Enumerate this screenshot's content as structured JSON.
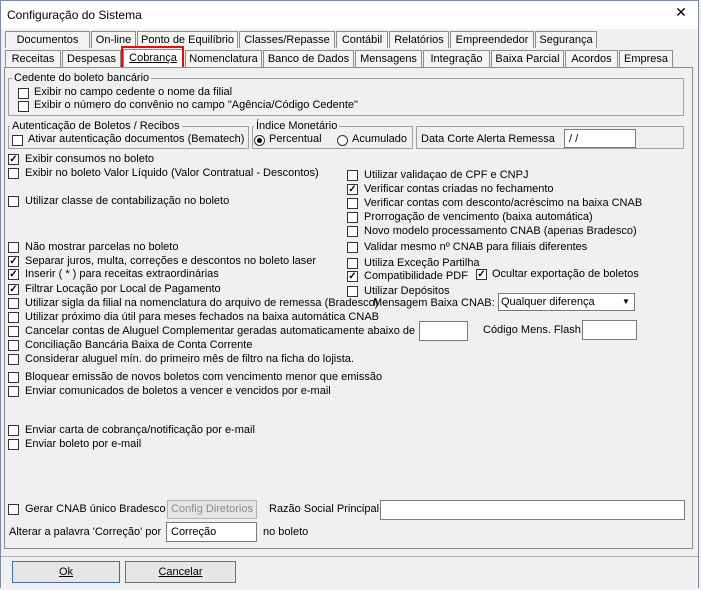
{
  "window": {
    "title": "Configuração do Sistema",
    "close_glyph": "✕"
  },
  "tabs_row1": [
    "Documentos",
    "On-line",
    "Ponto de Equilíbrio",
    "Classes/Repasse",
    "Contábil",
    "Relatórios",
    "Empreendedor",
    "Segurança"
  ],
  "tabs_row2": [
    "Receitas",
    "Despesas",
    "Cobrança",
    "Nomenclatura",
    "Banco de Dados",
    "Mensagens",
    "Integração",
    "Baixa Parcial",
    "Acordos",
    "Empresa"
  ],
  "cedente": {
    "title": "Cedente do boleto bancário",
    "opt1": "Exibir no campo cedente o nome da filial",
    "opt2": "Exibir o número do convênio no campo \"Agência/Código Cedente\""
  },
  "autenticacao": {
    "title": "Autenticação de Boletos / Recibos",
    "opt1": "Ativar autenticação documentos (Bematech)"
  },
  "indice": {
    "title": "Índice Monetário",
    "radio1": "Percentual",
    "radio2": "Acumulado"
  },
  "data_corte": {
    "label": "Data Corte Alerta Remessa",
    "value": "/ /"
  },
  "left_opts": {
    "exibir_consumos": "Exibir consumos no boleto",
    "exibir_valor_liquido": "Exibir no boleto Valor Líquido (Valor Contratual - Descontos)",
    "classe_contab": "Utilizar classe de contabilização no boleto",
    "nao_mostrar_parcelas": "Não mostrar parcelas no boleto",
    "separar_juros": "Separar juros, multa, correções e descontos no boleto laser",
    "inserir": "Inserir ( * ) para receitas extraordinárias",
    "filtrar_locacao": "Filtrar Locação por Local de Pagamento",
    "sigla_filial": "Utilizar sigla da filial na nomenclatura do arquivo de remessa (Bradesco)",
    "proximo_dia": "Utilizar próximo dia útil para meses fechados na baixa automática CNAB",
    "cancelar_contas": "Cancelar contas de Aluguel Complementar geradas automaticamente abaixo de R$",
    "conciliacao": "Conciliação Bancária Baixa de Conta Corrente",
    "considerar_aluguel": "Considerar aluguel mín. do primeiro mês de filtro na ficha do lojista.",
    "bloquear_emissao": "Bloquear emissão de novos boletos com vencimento menor que emissão",
    "enviar_comunicados": "Enviar comunicados de boletos a vencer e vencidos por e-mail",
    "enviar_carta": "Enviar carta de cobrança/notificação por e-mail",
    "enviar_boleto": "Enviar boleto por e-mail"
  },
  "right_opts": {
    "validacao_cpf": "Utilizar validaçao de CPF e CNPJ",
    "verificar_criadas": "Verificar contas criadas no fechamento",
    "verificar_desconto": "Verificar contas com desconto/acréscimo na baixa CNAB",
    "prorrogacao": "Prorrogação de vencimento (baixa automática)",
    "novo_modelo": "Novo modelo processamento CNAB (apenas Bradesco)",
    "validar_mesmo": "Validar mesmo nº CNAB para filiais diferentes",
    "excecao_partilha": "Utiliza Exceção Partilha",
    "compat_pdf": "Compatibilidade PDF",
    "ocultar_exportacao": "Ocultar exportação de boletos",
    "utilizar_depositos": "Utilizar Depósitos"
  },
  "mensagem_baixa": {
    "label": "Mensagem Baixa CNAB:",
    "value": "Qualquer diferença"
  },
  "codigo_mens": {
    "label": "Código Mens. Flash:",
    "value": ""
  },
  "cancelar_valor": "",
  "gerar_cnab": {
    "label": "Gerar CNAB único Bradesco",
    "button": "Config Diretorios"
  },
  "razao_social": {
    "label": "Razão Social Principal",
    "value": ""
  },
  "alterar_palavra": {
    "label": "Alterar a palavra 'Correção' por",
    "value": "Correção",
    "suffix": "no boleto"
  },
  "footer": {
    "ok": "Ok",
    "cancel": "Cancelar"
  }
}
